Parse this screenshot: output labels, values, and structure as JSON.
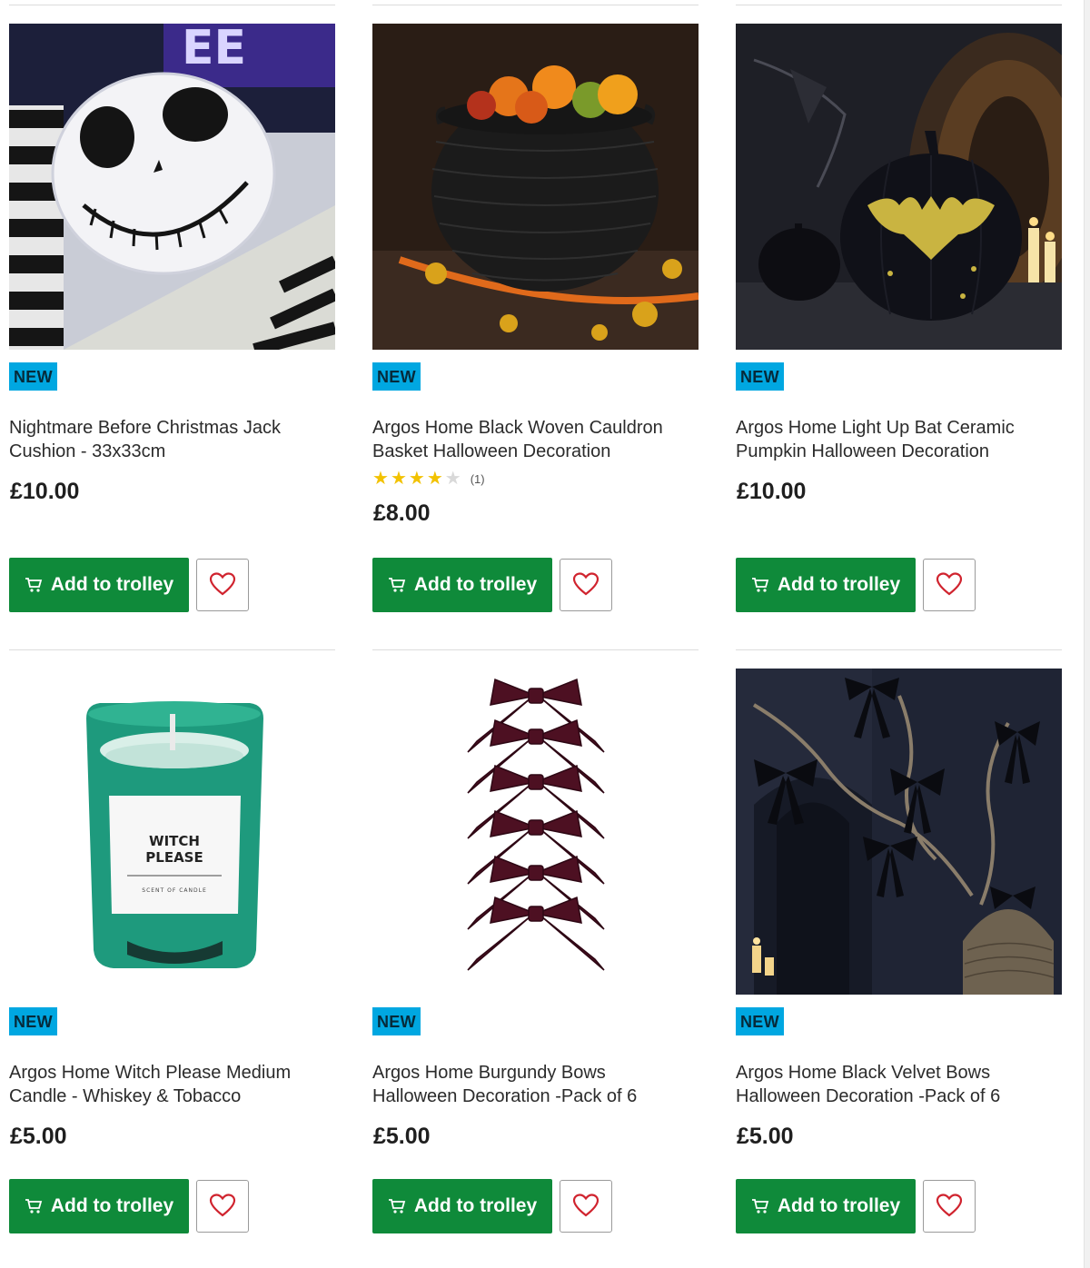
{
  "labels": {
    "add_to_trolley": "Add to trolley",
    "new_badge": "NEW"
  },
  "colors": {
    "accent_green": "#0f8a3a",
    "badge_blue": "#00a7e1",
    "star_yellow": "#f2c200",
    "heart_red": "#d0232e"
  },
  "icons": [
    "trolley-icon",
    "heart-icon",
    "star-icon"
  ],
  "products": [
    {
      "badge": "NEW",
      "title": "Nightmare Before Christmas Jack Cushion - 33x33cm",
      "price": "£10.00",
      "image": "jack-skellington-cushion"
    },
    {
      "badge": "NEW",
      "title": "Argos Home Black Woven Cauldron Basket Halloween Decoration",
      "rating": 4,
      "rating_max": 5,
      "review_count": "(1)",
      "price": "£8.00",
      "image": "black-woven-cauldron-basket"
    },
    {
      "badge": "NEW",
      "title": "Argos Home Light Up Bat Ceramic Pumpkin Halloween Decoration",
      "price": "£10.00",
      "image": "black-ceramic-pumpkin-bat"
    },
    {
      "badge": "NEW",
      "title": "Argos Home Witch Please Medium Candle - Whiskey & Tobacco",
      "price": "£5.00",
      "image": "green-witch-please-candle",
      "image_text": [
        "WITCH",
        "PLEASE",
        "SCENT OF CANDLE"
      ]
    },
    {
      "badge": "NEW",
      "title": "Argos Home Burgundy Bows Halloween Decoration -Pack of 6",
      "price": "£5.00",
      "image": "burgundy-velvet-bows"
    },
    {
      "badge": "NEW",
      "title": "Argos Home Black Velvet Bows Halloween Decoration -Pack of 6",
      "price": "£5.00",
      "image": "black-velvet-bows-branches"
    }
  ]
}
